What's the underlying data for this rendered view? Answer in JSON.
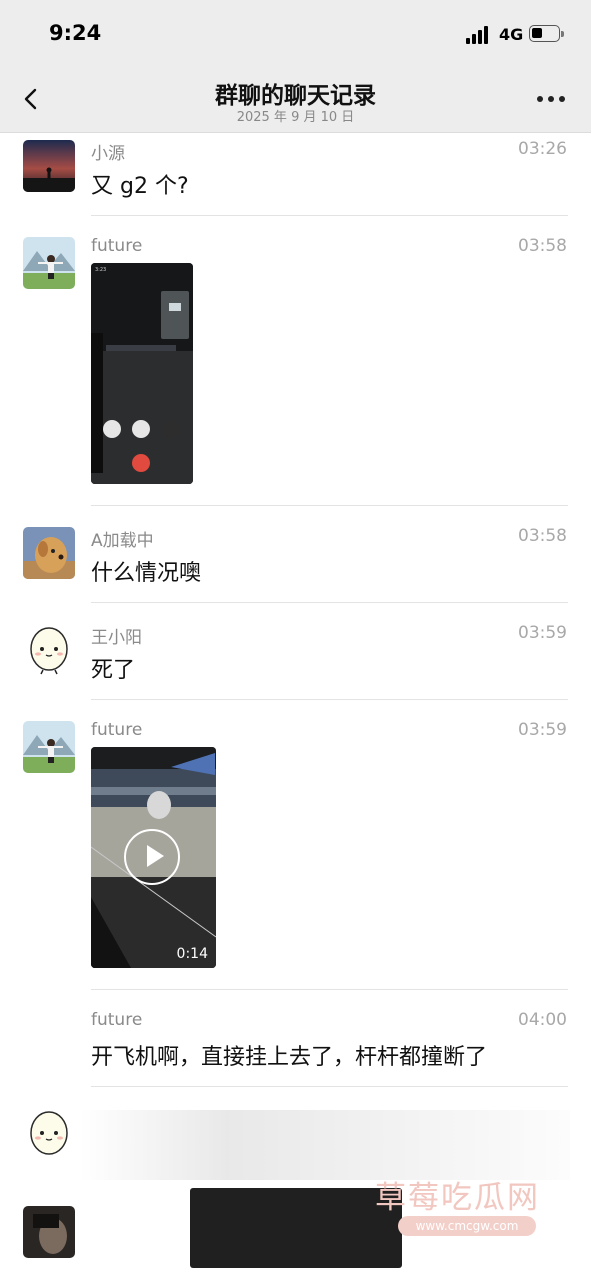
{
  "status_bar": {
    "time": "9:24",
    "network": "4G",
    "signal_icon": "signal-bars-icon",
    "battery_level": 0.4
  },
  "nav": {
    "title": "群聊的聊天记录",
    "subtitle": "2025 年 9 月 10 日"
  },
  "messages": [
    {
      "name": "小源",
      "time": "03:26",
      "text": "又 g2 个?"
    },
    {
      "name": "future",
      "time": "03:58",
      "type": "image"
    },
    {
      "name": "A加载中",
      "time": "03:58",
      "text": "什么情况噢"
    },
    {
      "name": "王小阳",
      "time": "03:59",
      "text": "死了"
    },
    {
      "name": "future",
      "time": "03:59",
      "type": "video",
      "duration": "0:14"
    },
    {
      "name": "future",
      "time": "04:00",
      "text": "开飞机啊，直接挂上去了，杆杆都撞断了"
    }
  ],
  "watermark": {
    "text": "草莓吃瓜网",
    "url": "www.cmcgw.com"
  },
  "colors": {
    "bar_bg": "#ededed",
    "name_gray": "#8a8a8a",
    "time_gray": "#a8a8a8",
    "watermark": "#f1c7c0"
  }
}
